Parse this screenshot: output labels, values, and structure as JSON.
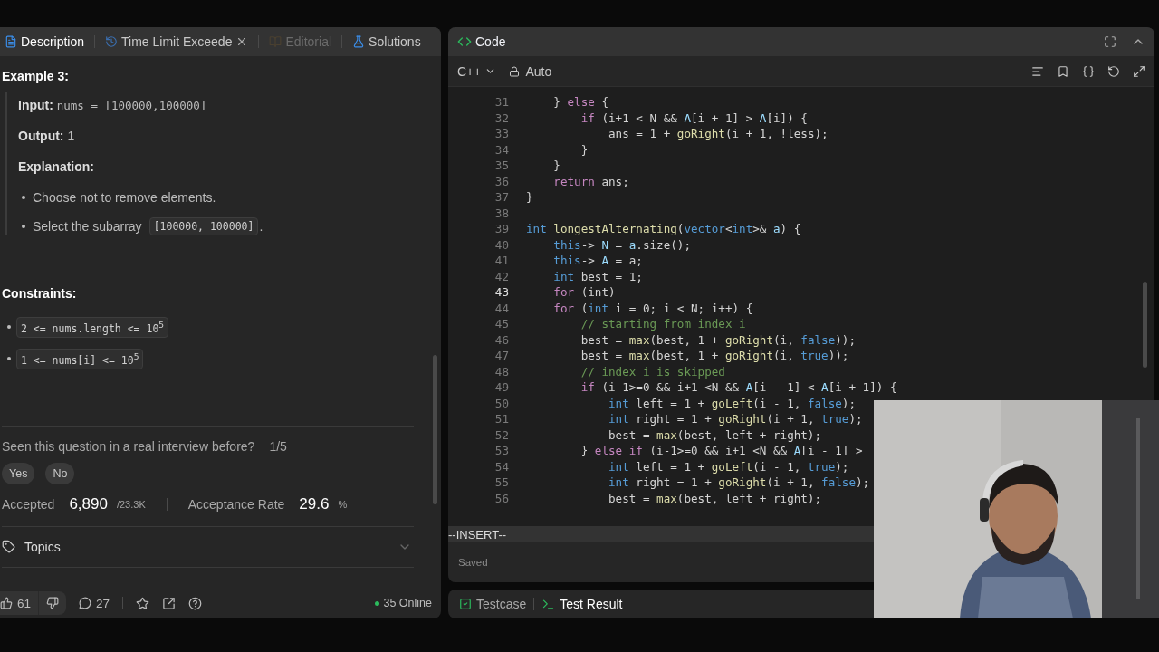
{
  "left_panel": {
    "tabs": [
      {
        "label": "Description",
        "selected": true,
        "disabled": false,
        "closable": false
      },
      {
        "label": "Time Limit Exceede",
        "selected": false,
        "disabled": false,
        "closable": true
      },
      {
        "label": "Editorial",
        "selected": false,
        "disabled": true,
        "closable": false
      },
      {
        "label": "Solutions",
        "selected": false,
        "disabled": false,
        "closable": false
      }
    ],
    "example": {
      "title": "Example 3:",
      "input_label": "Input:",
      "input": "nums = [100000,100000]",
      "output_label": "Output:",
      "output": "1",
      "explanation_label": "Explanation:",
      "bullets": [
        {
          "text": "Choose not to remove elements."
        },
        {
          "text": "Select the subarray",
          "code": "[100000, 100000]",
          "end": "."
        }
      ]
    },
    "constraints": {
      "title": "Constraints:",
      "items": [
        "2 <= nums.length <= 10$^{5}$",
        "1 <= nums[i] <= 10$^{5}$"
      ]
    },
    "interview": {
      "question": "Seen this question in a real interview before?",
      "count": "1/5",
      "buttons": [
        "Yes",
        "No"
      ]
    },
    "stats": [
      {
        "label": "Accepted",
        "value": "6,890",
        "suffix": "/23.3K"
      },
      {
        "label": "Acceptance Rate",
        "value": "29.6",
        "suffix": "%"
      }
    ],
    "topics": {
      "label": "Topics",
      "expanded": false
    },
    "footer": {
      "likes": "61",
      "comments": "27",
      "online": "35 Online"
    }
  },
  "code_panel": {
    "title": "Code",
    "language": "C++",
    "mode": "Auto",
    "lines": [
      {
        "number": "31",
        "current": false,
        "tokens": [
          {
            "kind": "plain",
            "text": "    } "
          },
          {
            "kind": "kw",
            "text": "else"
          },
          {
            "kind": "plain",
            "text": " {"
          }
        ]
      },
      {
        "number": "32",
        "current": false,
        "tokens": [
          {
            "kind": "kw",
            "text": "        if"
          },
          {
            "kind": "plain",
            "text": " (i+1 < N && "
          },
          {
            "kind": "var",
            "text": "A"
          },
          {
            "kind": "plain",
            "text": "[i + 1] > "
          },
          {
            "kind": "var",
            "text": "A"
          },
          {
            "kind": "plain",
            "text": "[i]) {"
          }
        ]
      },
      {
        "number": "33",
        "current": false,
        "tokens": [
          {
            "kind": "plain",
            "text": "            ans = 1 + "
          },
          {
            "kind": "fn",
            "text": "goRight"
          },
          {
            "kind": "plain",
            "text": "(i + 1, !less);"
          }
        ]
      },
      {
        "number": "34",
        "current": false,
        "tokens": [
          {
            "kind": "plain",
            "text": "        }"
          }
        ]
      },
      {
        "number": "35",
        "current": false,
        "tokens": [
          {
            "kind": "plain",
            "text": "    }"
          }
        ]
      },
      {
        "number": "36",
        "current": false,
        "tokens": [
          {
            "kind": "kw",
            "text": "    return"
          },
          {
            "kind": "plain",
            "text": " ans;"
          }
        ]
      },
      {
        "number": "37",
        "current": false,
        "tokens": [
          {
            "kind": "plain",
            "text": "}"
          }
        ]
      },
      {
        "number": "38",
        "current": false
      },
      {
        "number": "39",
        "current": false,
        "tokens": [
          {
            "kind": "type",
            "text": "int"
          },
          {
            "kind": "fn",
            "text": " longestAlternating"
          },
          {
            "kind": "plain",
            "text": "("
          },
          {
            "kind": "type",
            "text": "vector"
          },
          {
            "kind": "plain",
            "text": "<"
          },
          {
            "kind": "type",
            "text": "int"
          },
          {
            "kind": "plain",
            "text": ">& "
          },
          {
            "kind": "var",
            "text": "a"
          },
          {
            "kind": "plain",
            "text": ") {"
          }
        ]
      },
      {
        "number": "40",
        "current": false,
        "tokens": [
          {
            "kind": "type",
            "text": "    this"
          },
          {
            "kind": "plain",
            "text": "-> "
          },
          {
            "kind": "var",
            "text": "N"
          },
          {
            "kind": "plain",
            "text": " = "
          },
          {
            "kind": "var",
            "text": "a"
          },
          {
            "kind": "plain",
            "text": ".size();"
          }
        ]
      },
      {
        "number": "41",
        "current": false,
        "tokens": [
          {
            "kind": "type",
            "text": "    this"
          },
          {
            "kind": "plain",
            "text": "-> "
          },
          {
            "kind": "var",
            "text": "A"
          },
          {
            "kind": "plain",
            "text": " = a;"
          }
        ]
      },
      {
        "number": "42",
        "current": false,
        "tokens": [
          {
            "kind": "type",
            "text": "    int"
          },
          {
            "kind": "plain",
            "text": " best = 1;"
          }
        ]
      },
      {
        "number": "43",
        "current": true,
        "tokens": [
          {
            "kind": "kw",
            "text": "    for"
          },
          {
            "kind": "plain",
            "text": " (int)"
          }
        ]
      },
      {
        "number": "44",
        "current": false,
        "tokens": [
          {
            "kind": "kw",
            "text": "    for"
          },
          {
            "kind": "plain",
            "text": " ("
          },
          {
            "kind": "type",
            "text": "int"
          },
          {
            "kind": "plain",
            "text": " i = 0; i < N; i++) {"
          }
        ]
      },
      {
        "number": "45",
        "current": false,
        "tokens": [
          {
            "kind": "comment",
            "text": "        // starting from index i"
          }
        ]
      },
      {
        "number": "46",
        "current": false,
        "tokens": [
          {
            "kind": "plain",
            "text": "        best = "
          },
          {
            "kind": "fn",
            "text": "max"
          },
          {
            "kind": "plain",
            "text": "(best, 1 + "
          },
          {
            "kind": "fn",
            "text": "goRight"
          },
          {
            "kind": "plain",
            "text": "(i, "
          },
          {
            "kind": "type",
            "text": "false"
          },
          {
            "kind": "plain",
            "text": "));"
          }
        ]
      },
      {
        "number": "47",
        "current": false,
        "tokens": [
          {
            "kind": "plain",
            "text": "        best = "
          },
          {
            "kind": "fn",
            "text": "max"
          },
          {
            "kind": "plain",
            "text": "(best, 1 + "
          },
          {
            "kind": "fn",
            "text": "goRight"
          },
          {
            "kind": "plain",
            "text": "(i, "
          },
          {
            "kind": "type",
            "text": "true"
          },
          {
            "kind": "plain",
            "text": "));"
          }
        ]
      },
      {
        "number": "48",
        "current": false,
        "tokens": [
          {
            "kind": "comment",
            "text": "        // index i is skipped"
          }
        ]
      },
      {
        "number": "49",
        "current": false,
        "tokens": [
          {
            "kind": "kw",
            "text": "        if"
          },
          {
            "kind": "plain",
            "text": " (i-1>=0 && i+1 <N && "
          },
          {
            "kind": "var",
            "text": "A"
          },
          {
            "kind": "plain",
            "text": "[i - 1] < "
          },
          {
            "kind": "var",
            "text": "A"
          },
          {
            "kind": "plain",
            "text": "[i + 1]) {"
          }
        ]
      },
      {
        "number": "50",
        "current": false,
        "tokens": [
          {
            "kind": "type",
            "text": "            int"
          },
          {
            "kind": "plain",
            "text": " left = 1 + "
          },
          {
            "kind": "fn",
            "text": "goLeft"
          },
          {
            "kind": "plain",
            "text": "(i - 1, "
          },
          {
            "kind": "type",
            "text": "false"
          },
          {
            "kind": "plain",
            "text": ");"
          }
        ]
      },
      {
        "number": "51",
        "current": false,
        "tokens": [
          {
            "kind": "type",
            "text": "            int"
          },
          {
            "kind": "plain",
            "text": " right = 1 + "
          },
          {
            "kind": "fn",
            "text": "goRight"
          },
          {
            "kind": "plain",
            "text": "(i + 1, "
          },
          {
            "kind": "type",
            "text": "true"
          },
          {
            "kind": "plain",
            "text": ");"
          }
        ]
      },
      {
        "number": "52",
        "current": false,
        "tokens": [
          {
            "kind": "plain",
            "text": "            best = "
          },
          {
            "kind": "fn",
            "text": "max"
          },
          {
            "kind": "plain",
            "text": "(best, left + right);"
          }
        ]
      },
      {
        "number": "53",
        "current": false,
        "tokens": [
          {
            "kind": "plain",
            "text": "        } "
          },
          {
            "kind": "kw",
            "text": "else if"
          },
          {
            "kind": "plain",
            "text": " (i-1>=0 && i+1 <N && "
          },
          {
            "kind": "var",
            "text": "A"
          },
          {
            "kind": "plain",
            "text": "[i - 1] >"
          }
        ]
      },
      {
        "number": "54",
        "current": false,
        "tokens": [
          {
            "kind": "type",
            "text": "            int"
          },
          {
            "kind": "plain",
            "text": " left = 1 + "
          },
          {
            "kind": "fn",
            "text": "goLeft"
          },
          {
            "kind": "plain",
            "text": "(i - 1, "
          },
          {
            "kind": "type",
            "text": "true"
          },
          {
            "kind": "plain",
            "text": ");"
          }
        ]
      },
      {
        "number": "55",
        "current": false,
        "tokens": [
          {
            "kind": "type",
            "text": "            int"
          },
          {
            "kind": "plain",
            "text": " right = 1 + "
          },
          {
            "kind": "fn",
            "text": "goRight"
          },
          {
            "kind": "plain",
            "text": "(i + 1, "
          },
          {
            "kind": "type",
            "text": "false"
          },
          {
            "kind": "plain",
            "text": ");"
          }
        ]
      },
      {
        "number": "56",
        "current": false,
        "tokens": [
          {
            "kind": "plain",
            "text": "            best = "
          },
          {
            "kind": "fn",
            "text": "max"
          },
          {
            "kind": "plain",
            "text": "(best, left + right);"
          }
        ]
      }
    ],
    "status": "--INSERT--",
    "save_state": "Saved"
  },
  "bottom_tabs": [
    {
      "label": "Testcase",
      "selected": false
    },
    {
      "label": "Test Result",
      "selected": true
    }
  ]
}
